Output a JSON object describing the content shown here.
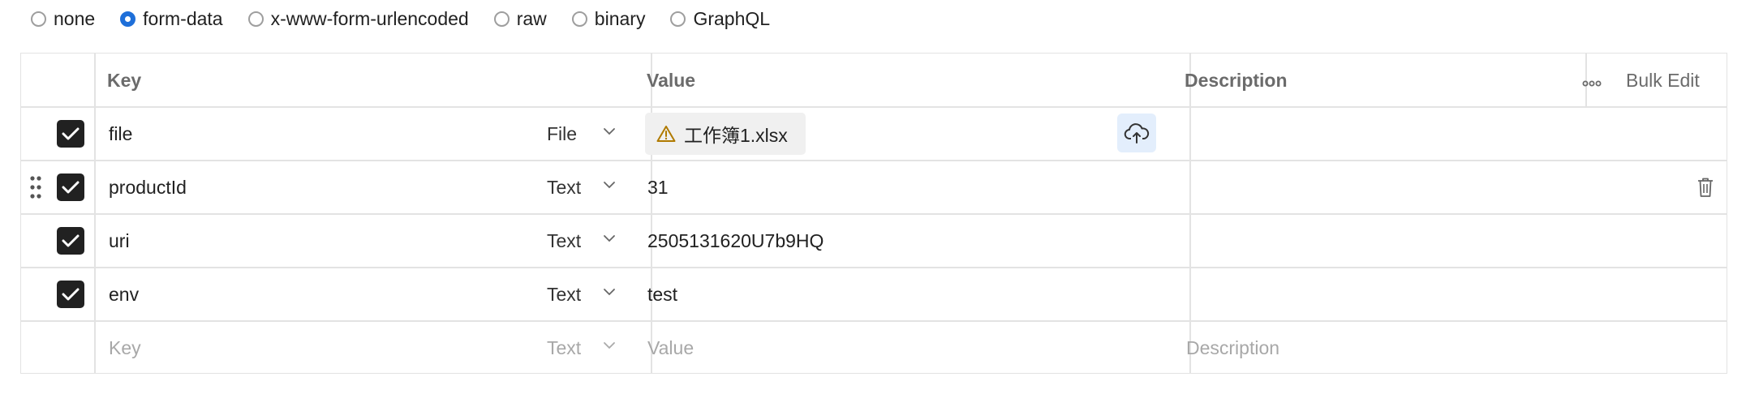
{
  "body_type_options": [
    {
      "label": "none",
      "selected": false
    },
    {
      "label": "form-data",
      "selected": true
    },
    {
      "label": "x-www-form-urlencoded",
      "selected": false
    },
    {
      "label": "raw",
      "selected": false
    },
    {
      "label": "binary",
      "selected": false
    },
    {
      "label": "GraphQL",
      "selected": false
    }
  ],
  "table": {
    "headers": {
      "key": "Key",
      "value": "Value",
      "description": "Description"
    },
    "bulk_edit_label": "Bulk Edit",
    "rows": [
      {
        "enabled": true,
        "key": "file",
        "type": "File",
        "value": "工作簿1.xlsx",
        "description": ""
      },
      {
        "enabled": true,
        "key": "productId",
        "type": "Text",
        "value": "31",
        "description": ""
      },
      {
        "enabled": true,
        "key": "uri",
        "type": "Text",
        "value": "2505131620U7b9HQ",
        "description": ""
      },
      {
        "enabled": true,
        "key": "env",
        "type": "Text",
        "value": "test",
        "description": ""
      }
    ],
    "new_row": {
      "key_placeholder": "Key",
      "type": "Text",
      "value_placeholder": "Value",
      "description_placeholder": "Description"
    }
  },
  "colors": {
    "accent": "#1e6fd9",
    "checkbox": "#212121",
    "warning": "#b07a00",
    "border": "#e3e3e3"
  },
  "icons": [
    "radio-icon",
    "checkbox-check-icon",
    "chevron-down-icon",
    "warning-icon",
    "cloud-upload-icon",
    "drag-handle-icon",
    "trash-icon",
    "more-icon"
  ]
}
